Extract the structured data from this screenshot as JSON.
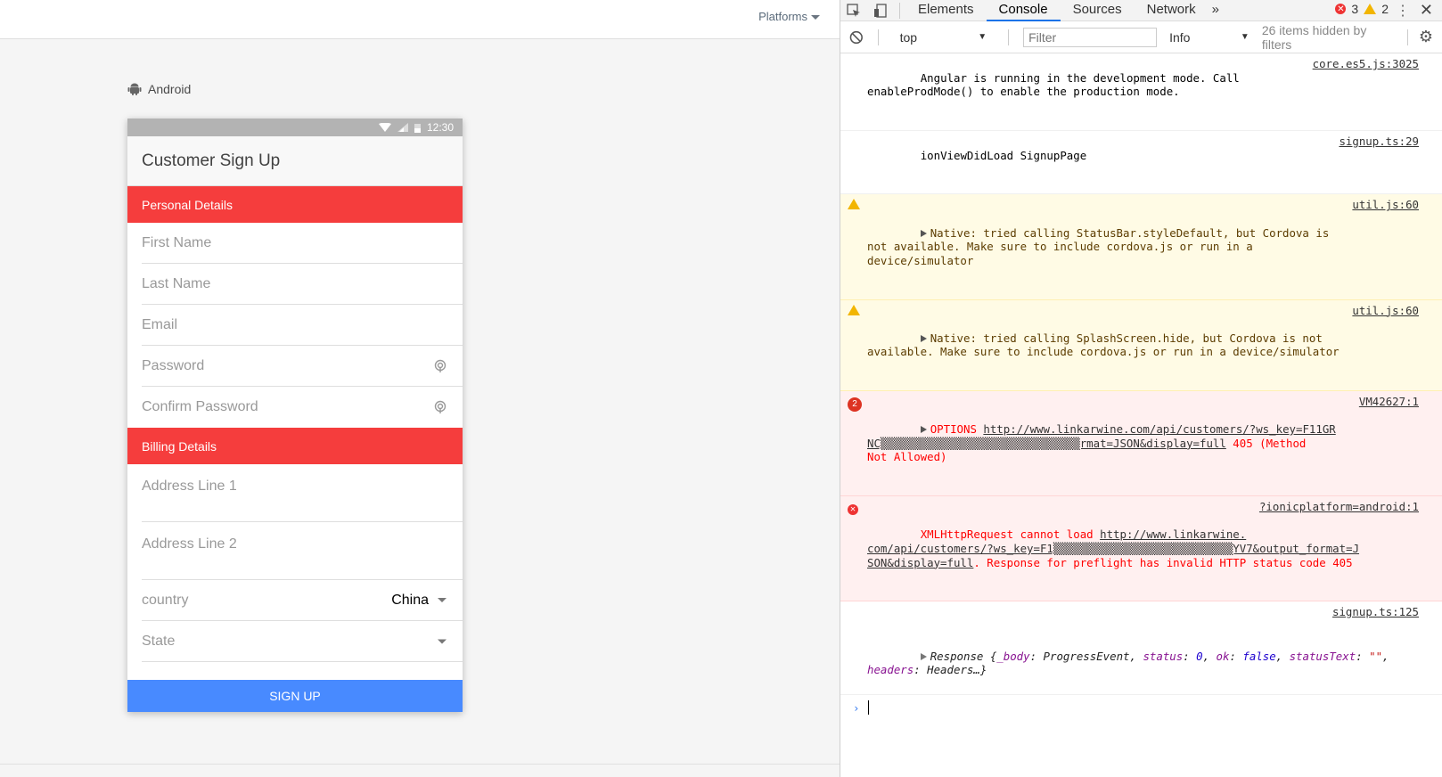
{
  "preview": {
    "platforms_label": "Platforms",
    "platform_name": "Android",
    "status_time": "12:30",
    "page_title": "Customer Sign Up",
    "section_personal": "Personal Details",
    "section_billing": "Billing Details",
    "fields": {
      "first_name": "First Name",
      "last_name": "Last Name",
      "email": "Email",
      "password": "Password",
      "confirm_password": "Confirm Password",
      "address1": "Address Line 1",
      "address2": "Address Line 2",
      "country_label": "country",
      "country_value": "China",
      "state_label": "State"
    },
    "signup_button": "SIGN UP",
    "accent_color": "#f53d3d",
    "primary_color": "#488aff"
  },
  "devtools": {
    "tabs": [
      "Elements",
      "Console",
      "Sources",
      "Network"
    ],
    "active_tab": "Console",
    "more_tabs": "»",
    "error_count": "3",
    "warning_count": "2",
    "context": "top",
    "filter_placeholder": "Filter",
    "level": "Info",
    "hidden_note": "26 items hidden by filters"
  },
  "console": {
    "m1": {
      "text": "Angular is running in the development mode. Call\nenableProdMode() to enable the production mode.",
      "src": "core.es5.js:3025"
    },
    "m2": {
      "text": "ionViewDidLoad SignupPage",
      "src": "signup.ts:29"
    },
    "m3": {
      "text": "Native: tried calling StatusBar.styleDefault, but Cordova is\nnot available. Make sure to include cordova.js or run in a\ndevice/simulator",
      "src": "util.js:60"
    },
    "m4": {
      "text": "Native: tried calling SplashScreen.hide, but Cordova is not\navailable. Make sure to include cordova.js or run in a device/simulator",
      "src": "util.js:60"
    },
    "m5": {
      "count": "2",
      "method": "OPTIONS",
      "url": "http://www.linkarwine.com/api/customers/?ws_key=F11GR\nNC▒▒▒▒▒▒▒▒▒▒▒▒▒▒▒▒▒▒▒▒▒▒▒▒▒▒▒▒▒▒rmat=JSON&display=full",
      "status": " 405 (Method\nNot Allowed)",
      "src": "VM42627:1"
    },
    "m6": {
      "text": "XMLHttpRequest cannot load ",
      "url": "http://www.linkarwine.\ncom/api/customers/?ws_key=F1▒▒▒▒▒▒▒▒▒▒▒▒▒▒▒▒▒▒▒▒▒▒▒▒▒▒▒YV7&output_format=J\nSON&display=full",
      "tail": ". Response for preflight has invalid HTTP status code 405",
      "src": "?ionicplatform=android:1"
    },
    "m7": {
      "src": "signup.ts:125",
      "label": "Response ",
      "body_key": "_body",
      "body_val": "ProgressEvent",
      "status_key": "status",
      "status_val": "0",
      "ok_key": "ok",
      "ok_val": "false",
      "statustext_key": "statusText",
      "statustext_val": "\"\"",
      "headers_key": "headers",
      "headers_val": "Headers…}"
    }
  }
}
